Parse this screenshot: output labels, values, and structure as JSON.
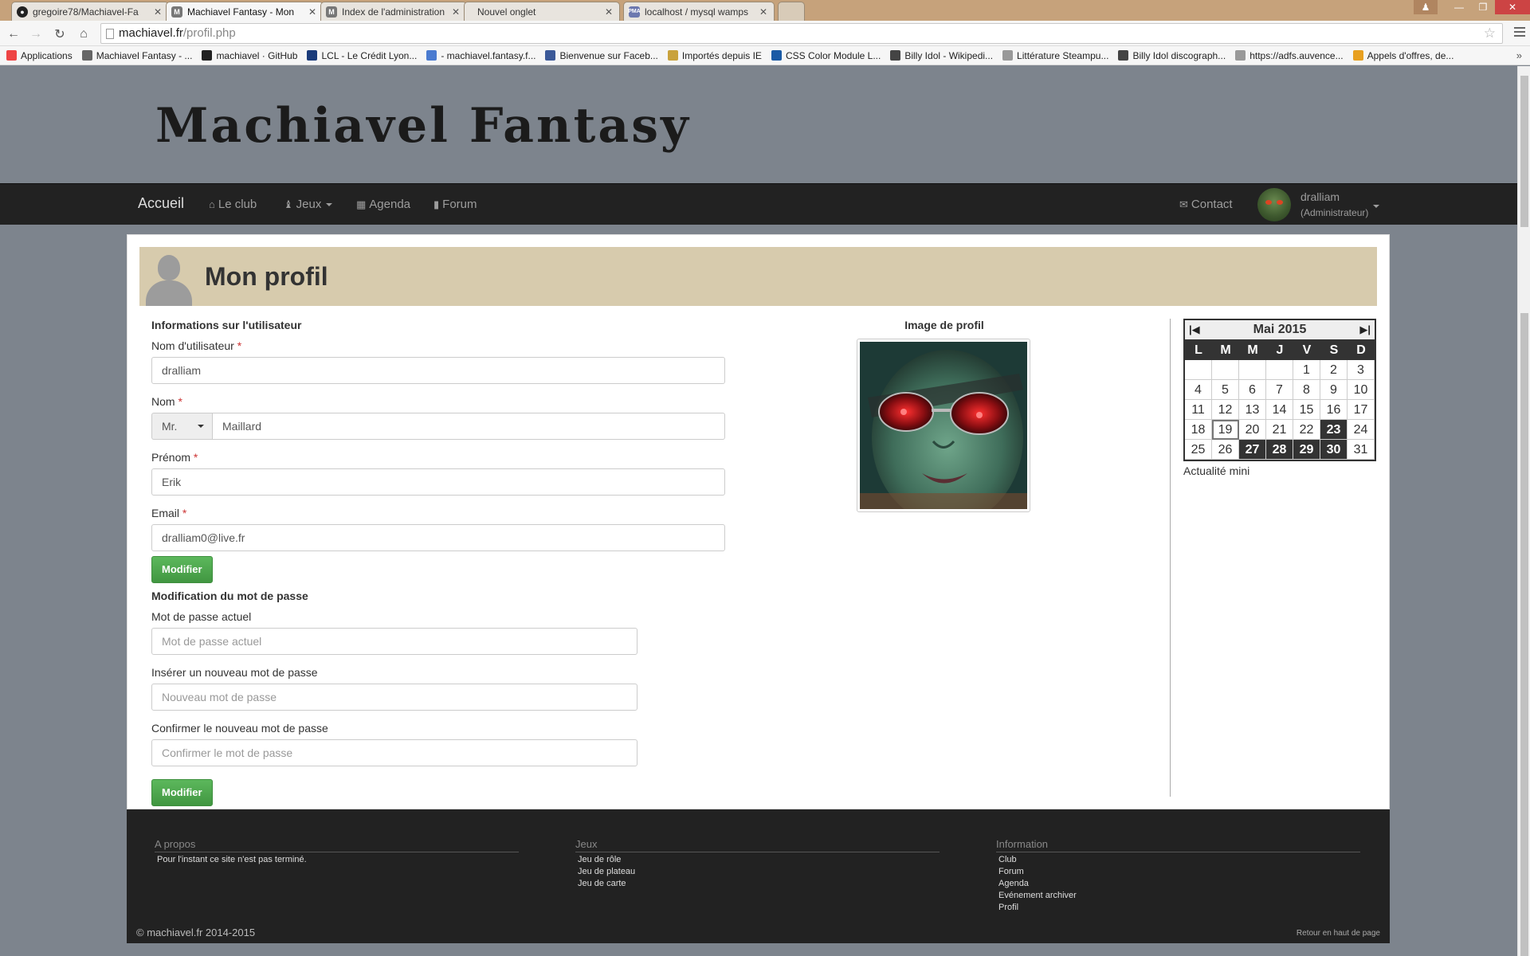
{
  "browser": {
    "tabs": [
      {
        "label": "gregoire78/Machiavel-Fa",
        "favicon": "github-icon",
        "active": false
      },
      {
        "label": "Machiavel Fantasy - Mon",
        "favicon": "machiavel-icon",
        "active": true
      },
      {
        "label": "Index de l'administration",
        "favicon": "machiavel-icon",
        "active": false
      },
      {
        "label": "Nouvel onglet",
        "favicon": "",
        "active": false
      },
      {
        "label": "localhost / mysql wamps",
        "favicon": "phpmyadmin-icon",
        "active": false
      }
    ],
    "url_host": "machiavel.fr",
    "url_path": "/profil.php",
    "bookmarks": [
      {
        "label": "Applications",
        "icon": "apps-grid-icon",
        "color": "#e44"
      },
      {
        "label": "Machiavel Fantasy - ...",
        "icon": "machiavel-icon",
        "color": "#666"
      },
      {
        "label": "machiavel · GitHub",
        "icon": "github-icon",
        "color": "#222"
      },
      {
        "label": "LCL - Le Crédit Lyon...",
        "icon": "lcl-icon",
        "color": "#1a3b7a"
      },
      {
        "label": "- machiavel.fantasy.f...",
        "icon": "google-plus-icon",
        "color": "#4a7bd0"
      },
      {
        "label": "Bienvenue sur Faceb...",
        "icon": "facebook-icon",
        "color": "#3b5998"
      },
      {
        "label": "Importés depuis IE",
        "icon": "folder-icon",
        "color": "#c9a23c"
      },
      {
        "label": "CSS Color Module L...",
        "icon": "w3c-icon",
        "color": "#1a5aa5"
      },
      {
        "label": "Billy Idol - Wikipedi...",
        "icon": "wikipedia-icon",
        "color": "#444"
      },
      {
        "label": "Littérature Steampu...",
        "icon": "page-icon",
        "color": "#999"
      },
      {
        "label": "Billy Idol discograph...",
        "icon": "wikipedia-icon",
        "color": "#444"
      },
      {
        "label": "https://adfs.auvence...",
        "icon": "page-icon",
        "color": "#999"
      },
      {
        "label": "Appels d'offres, de...",
        "icon": "appels-icon",
        "color": "#e8a020"
      }
    ]
  },
  "site": {
    "logo": "Machiavel Fantasy",
    "nav": {
      "brand": "Accueil",
      "items": [
        {
          "label": "Le club",
          "icon": "home-icon"
        },
        {
          "label": "Jeux",
          "icon": "chess-piece-icon",
          "dropdown": true
        },
        {
          "label": "Agenda",
          "icon": "calendar-icon"
        },
        {
          "label": "Forum",
          "icon": "comment-icon"
        }
      ],
      "contact": "Contact",
      "username": "dralliam",
      "role": "(Administrateur)"
    }
  },
  "profile": {
    "title": "Mon profil",
    "info_title": "Informations sur l'utilisateur",
    "username_label": "Nom d'utilisateur",
    "username": "dralliam",
    "nom_label": "Nom",
    "civility": "Mr.",
    "nom": "Maillard",
    "prenom_label": "Prénom",
    "prenom": "Erik",
    "email_label": "Email",
    "email": "dralliam0@live.fr",
    "required_mark": "*",
    "submit": "Modifier",
    "password_title": "Modification du mot de passe",
    "current_pw_label": "Mot de passe actuel",
    "current_pw_placeholder": "Mot de passe actuel",
    "new_pw_label": "Insérer un nouveau mot de passe",
    "new_pw_placeholder": "Nouveau mot de passe",
    "confirm_pw_label": "Confirmer le nouveau mot de passe",
    "confirm_pw_placeholder": "Confirmer le mot de passe",
    "submit2": "Modifier",
    "image_title": "Image de profil"
  },
  "calendar": {
    "title": "Mai 2015",
    "dow": [
      "L",
      "M",
      "M",
      "J",
      "V",
      "S",
      "D"
    ],
    "weeks": [
      [
        "",
        "",
        "",
        "",
        "1",
        "2",
        "3"
      ],
      [
        "4",
        "5",
        "6",
        "7",
        "8",
        "9",
        "10"
      ],
      [
        "11",
        "12",
        "13",
        "14",
        "15",
        "16",
        "17"
      ],
      [
        "18",
        "19",
        "20",
        "21",
        "22",
        "23",
        "24"
      ],
      [
        "25",
        "26",
        "27",
        "28",
        "29",
        "30",
        "31"
      ]
    ],
    "highlighted": [
      "23",
      "27",
      "28",
      "29",
      "30"
    ],
    "today": "19",
    "mini_news": "Actualité mini"
  },
  "footer": {
    "about_title": "A propos",
    "about_text": "Pour l'instant ce site n'est pas terminé.",
    "games_title": "Jeux",
    "games": [
      "Jeu de rôle",
      "Jeu de plateau",
      "Jeu de carte"
    ],
    "info_title": "Information",
    "info": [
      "Club",
      "Forum",
      "Agenda",
      "Evénement archiver",
      "Profil"
    ],
    "copyright": "© machiavel.fr 2014-2015",
    "back_to_top": "Retour en haut de page"
  }
}
